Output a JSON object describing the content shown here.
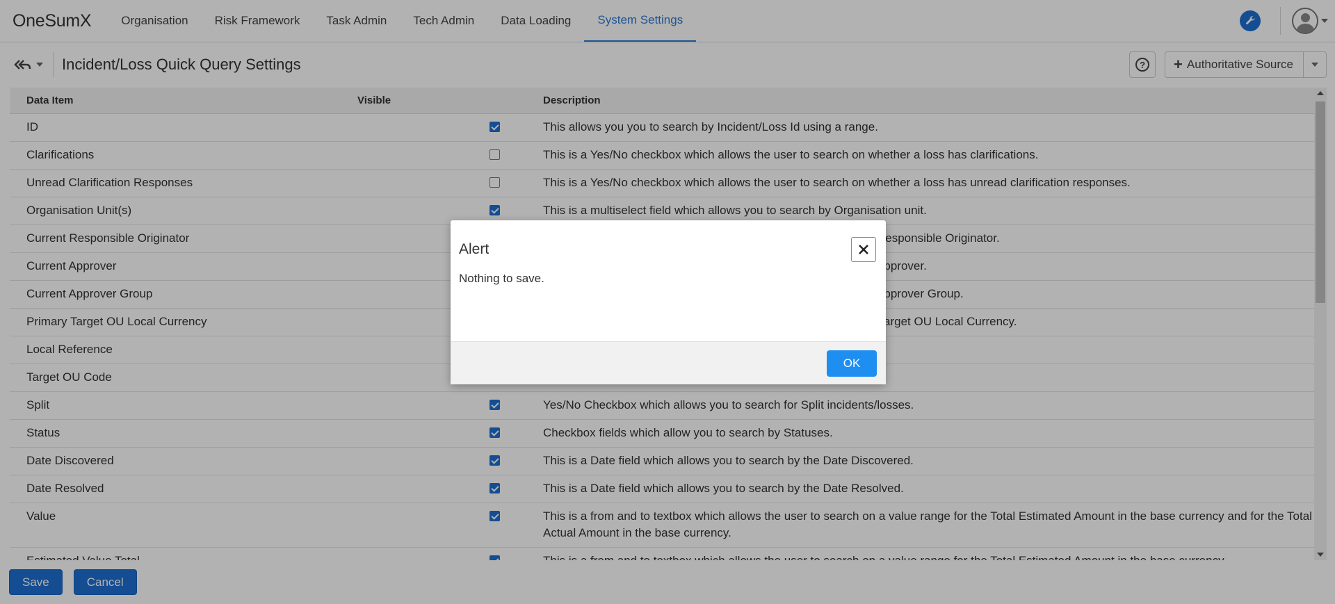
{
  "app": {
    "brand": "OneSumX",
    "nav": [
      {
        "label": "Organisation"
      },
      {
        "label": "Risk Framework"
      },
      {
        "label": "Task Admin"
      },
      {
        "label": "Tech Admin"
      },
      {
        "label": "Data Loading"
      },
      {
        "label": "System Settings",
        "active": true
      }
    ]
  },
  "header": {
    "title": "Incident/Loss Quick Query Settings",
    "help_label": "?",
    "authoritative_label": "Authoritative Source"
  },
  "table": {
    "columns": [
      "Data Item",
      "Visible",
      "Description"
    ],
    "rows": [
      {
        "item": "ID",
        "visible": true,
        "description": "This allows you you to search by Incident/Loss Id using a range."
      },
      {
        "item": "Clarifications",
        "visible": false,
        "description": "This is a Yes/No checkbox which allows the user to search on whether a loss has clarifications."
      },
      {
        "item": "Unread Clarification Responses",
        "visible": false,
        "description": "This is a Yes/No checkbox which allows the user to search on whether a loss has unread clarification responses."
      },
      {
        "item": "Organisation Unit(s)",
        "visible": true,
        "description": "This is a multiselect field which allows you to search by Organisation unit."
      },
      {
        "item": "Current Responsible Originator",
        "visible": true,
        "description": "This is a multiselect field which allows you to search by Current Responsible Originator."
      },
      {
        "item": "Current Approver",
        "visible": true,
        "description": "This is a multiselect field which allows you to search by Current Approver."
      },
      {
        "item": "Current Approver Group",
        "visible": true,
        "description": "This is a multiselect field which allows you to search by Current Approver Group."
      },
      {
        "item": "Primary Target OU Local Currency",
        "visible": true,
        "description": "This is a multiselect field which allows you to search by Primary Target OU Local Currency."
      },
      {
        "item": "Local Reference",
        "visible": true,
        "description": ""
      },
      {
        "item": "Target OU Code",
        "visible": true,
        "description": ""
      },
      {
        "item": "Split",
        "visible": true,
        "description": "Yes/No Checkbox which allows you to search for Split incidents/losses."
      },
      {
        "item": "Status",
        "visible": true,
        "description": "Checkbox fields which allow you to search by Statuses."
      },
      {
        "item": "Date Discovered",
        "visible": true,
        "description": "This is a Date field which allows you to search by the Date Discovered."
      },
      {
        "item": "Date Resolved",
        "visible": true,
        "description": "This is a Date field which allows you to search by the Date Resolved."
      },
      {
        "item": "Value",
        "visible": true,
        "description": "This is a from and to textbox which allows the user to search on a value range for the Total Estimated Amount in the base currency and for the Total Actual Amount in the base currency."
      },
      {
        "item": "Estimated Value Total",
        "visible": true,
        "description": "This is a from and to textbox which allows the user to search on a value range for the Total Estimated Amount in the base currency."
      }
    ]
  },
  "footer": {
    "save_label": "Save",
    "cancel_label": "Cancel"
  },
  "alert": {
    "title": "Alert",
    "message": "Nothing to save.",
    "ok_label": "OK"
  },
  "colors": {
    "accent": "#1d6fd1",
    "ok_button": "#1f8ef1",
    "nav_active": "#2b7bd5"
  }
}
